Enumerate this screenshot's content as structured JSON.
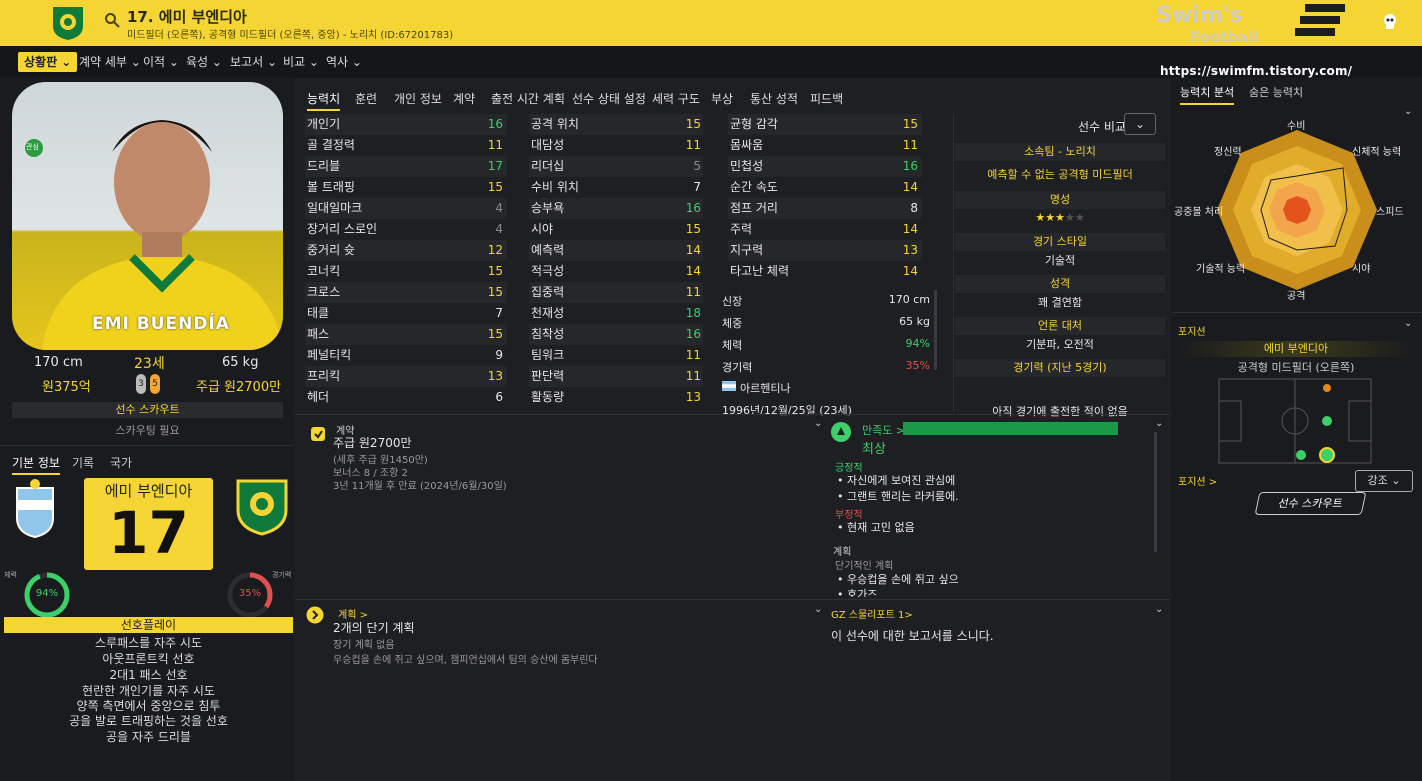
{
  "header": {
    "title": "17. 에미 부엔디아",
    "subtitle": "미드필더 (오른쪽), 공격형 미드필더 (오른쪽, 중앙) - 노리치 (ID:67201783)",
    "watermark_url": "https://swimfm.tistory.com/"
  },
  "nav": {
    "items": [
      "상황판",
      "계약 세부",
      "이적",
      "육성",
      "보고서",
      "비교",
      "역사"
    ]
  },
  "profile": {
    "height": "170 cm",
    "age": "23세",
    "weight": "65 kg",
    "value": "원375억",
    "wage": "주급 원2700만",
    "foot_left": "3",
    "foot_right": "5",
    "scout_label": "선수 스카우트",
    "scout_status": "스카우팅 필요",
    "portrait_name": "EMI BUENDÍA",
    "interest_badge": "관심"
  },
  "basic_tabs": [
    "기본 정보",
    "기록",
    "국가"
  ],
  "shirt": {
    "name": "에미 부엔디아",
    "number": "17"
  },
  "gauges": {
    "condition_label": "체력",
    "condition_value": "94%",
    "condition_level": 0.94,
    "sharpness_label": "경기력",
    "sharpness_value": "35%",
    "sharpness_level": 0.35
  },
  "preferred_moves": {
    "title": "선호플레이",
    "items": [
      "스루패스를 자주 시도",
      "아웃프론트킥 선호",
      "2대1 패스 선호",
      "현란한 개인기를 자주 시도",
      "양쪽 측면에서 중앙으로 침투",
      "공을 발로 트래핑하는 것을 선호",
      "공을 자주 드리블"
    ]
  },
  "tabs": [
    "능력치",
    "훈련",
    "개인 정보",
    "계약",
    "출전 시간 계획",
    "선수 상태 설정",
    "세력 구도",
    "부상",
    "통산 성적",
    "피드백"
  ],
  "attributes": {
    "technical": [
      {
        "name": "개인기",
        "value": "16",
        "tone": "green"
      },
      {
        "name": "골 결정력",
        "value": "11",
        "tone": "yellow"
      },
      {
        "name": "드리블",
        "value": "17",
        "tone": "green"
      },
      {
        "name": "볼 트래핑",
        "value": "15",
        "tone": "yellow"
      },
      {
        "name": "일대일마크",
        "value": "4",
        "tone": "gray"
      },
      {
        "name": "장거리 스로인",
        "value": "4",
        "tone": "gray"
      },
      {
        "name": "중거리 슛",
        "value": "12",
        "tone": "yellow"
      },
      {
        "name": "코너킥",
        "value": "15",
        "tone": "yellow"
      },
      {
        "name": "크로스",
        "value": "15",
        "tone": "yellow"
      },
      {
        "name": "태클",
        "value": "7",
        "tone": "white"
      },
      {
        "name": "패스",
        "value": "15",
        "tone": "yellow"
      },
      {
        "name": "페널티킥",
        "value": "9",
        "tone": "white"
      },
      {
        "name": "프리킥",
        "value": "13",
        "tone": "yellow"
      },
      {
        "name": "헤더",
        "value": "6",
        "tone": "white"
      }
    ],
    "mental": [
      {
        "name": "공격 위치",
        "value": "15",
        "tone": "yellow"
      },
      {
        "name": "대담성",
        "value": "11",
        "tone": "yellow"
      },
      {
        "name": "리더십",
        "value": "5",
        "tone": "gray"
      },
      {
        "name": "수비 위치",
        "value": "7",
        "tone": "white"
      },
      {
        "name": "승부욕",
        "value": "16",
        "tone": "green"
      },
      {
        "name": "시야",
        "value": "15",
        "tone": "yellow"
      },
      {
        "name": "예측력",
        "value": "14",
        "tone": "yellow"
      },
      {
        "name": "적극성",
        "value": "14",
        "tone": "yellow"
      },
      {
        "name": "집중력",
        "value": "11",
        "tone": "yellow"
      },
      {
        "name": "천재성",
        "value": "18",
        "tone": "green"
      },
      {
        "name": "침착성",
        "value": "16",
        "tone": "green"
      },
      {
        "name": "팀워크",
        "value": "11",
        "tone": "yellow"
      },
      {
        "name": "판단력",
        "value": "11",
        "tone": "yellow"
      },
      {
        "name": "활동량",
        "value": "13",
        "tone": "yellow"
      }
    ],
    "physical": [
      {
        "name": "균형 감각",
        "value": "15",
        "tone": "yellow"
      },
      {
        "name": "몸싸움",
        "value": "11",
        "tone": "yellow"
      },
      {
        "name": "민첩성",
        "value": "16",
        "tone": "green"
      },
      {
        "name": "순간 속도",
        "value": "14",
        "tone": "yellow"
      },
      {
        "name": "점프 거리",
        "value": "8",
        "tone": "white"
      },
      {
        "name": "주력",
        "value": "14",
        "tone": "yellow"
      },
      {
        "name": "지구력",
        "value": "13",
        "tone": "yellow"
      },
      {
        "name": "타고난 체력",
        "value": "14",
        "tone": "yellow"
      }
    ]
  },
  "bio": {
    "height_label": "신장",
    "height": "170 cm",
    "weight_label": "체중",
    "weight": "65 kg",
    "condition_label": "체력",
    "condition": "94%",
    "sharpness_label": "경기력",
    "sharpness": "35%",
    "nation": "아르헨티나",
    "dob": "1996년/12월/25일 (23세)"
  },
  "compare": {
    "label": "선수 비교",
    "club_line": "소속팀 - 노리치",
    "role_line": "예측할 수 없는 공격형 미드필더",
    "reputation_head": "명성",
    "reputation_stars": 3,
    "play_style_head": "경기 스타일",
    "play_style": "기술적",
    "personality_head": "성격",
    "personality": "꽤 결연함",
    "media_head": "언론 대처",
    "media": "기분파, 오전적",
    "form_head": "경기력 (지난 5경기)",
    "form_text": "아직 경기에 출전한 적이 없음"
  },
  "contract_card": {
    "title": "계약",
    "wage": "주급 원2700만",
    "after_tax": "(세후 주급 원1450만)",
    "bonus": "보너스 8 / 조항 2",
    "expiry": "3년 11개월 후 만료 (2024년/6월/30일)"
  },
  "happiness_card": {
    "title": "만족도 >",
    "level": "최상",
    "positive_head": "긍정적",
    "positives": [
      "자신에게 보여진 관심에",
      "그랜트 핸리는 라커룸에."
    ],
    "negative_head": "부정적",
    "negative": "현재 고민 없음",
    "plan_head": "계획",
    "plan_sub": "단기적인 계획",
    "plans": [
      "우승컵을 손에 쥐고 싶으",
      "호가즈"
    ]
  },
  "plan_card": {
    "title": "계획 >",
    "headline": "2개의 단기 계획",
    "line1": "장기 계획 없음",
    "line2": "우승컵을 손에 쥐고 싶으며, 챔피언십에서 팀의 승산에 몸부린다"
  },
  "report_card": {
    "title": "GZ 스물리포트 1>",
    "text": "이 선수에 대한 보고서를 스니다."
  },
  "right": {
    "tabs": [
      "능력치 분석",
      "숨은 능력치"
    ],
    "radar_labels": [
      "수비",
      "신체적 능력",
      "스피드",
      "시야",
      "공격",
      "기술적 능력",
      "공중볼 처리",
      "정신력"
    ],
    "position_head": "포지션",
    "best_role": "에미 부엔디아",
    "role_line": "공격형 미드필더 (오른쪽)",
    "position_link": "포지션 >",
    "highlight_select": "강조",
    "scout_button": "선수 스카우트"
  },
  "colors": {
    "brand_yellow": "#f4d534",
    "good": "#3ccf6a",
    "bad": "#e0504c"
  }
}
